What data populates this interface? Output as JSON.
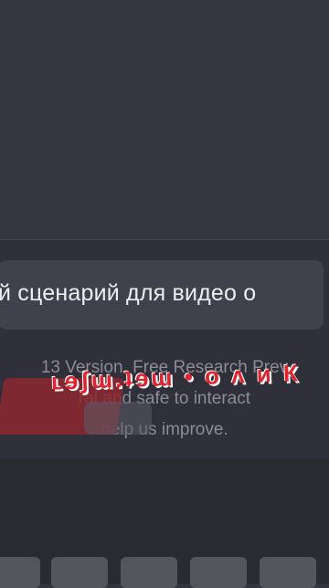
{
  "prompt": {
    "text": "й сценарий для видео о"
  },
  "footer": {
    "line1": "13 Version. Free Research Prev",
    "line2": "ral and safe to interact",
    "line3": "help us improve."
  },
  "overlay": {
    "channel_text": "ʟɘʃɯ.ʇɘɯ • ᴏ ᴧ и К"
  },
  "colors": {
    "background": "#34353f",
    "panel": "#2f3039",
    "input": "#40414c",
    "accent_red": "#e0232e"
  }
}
